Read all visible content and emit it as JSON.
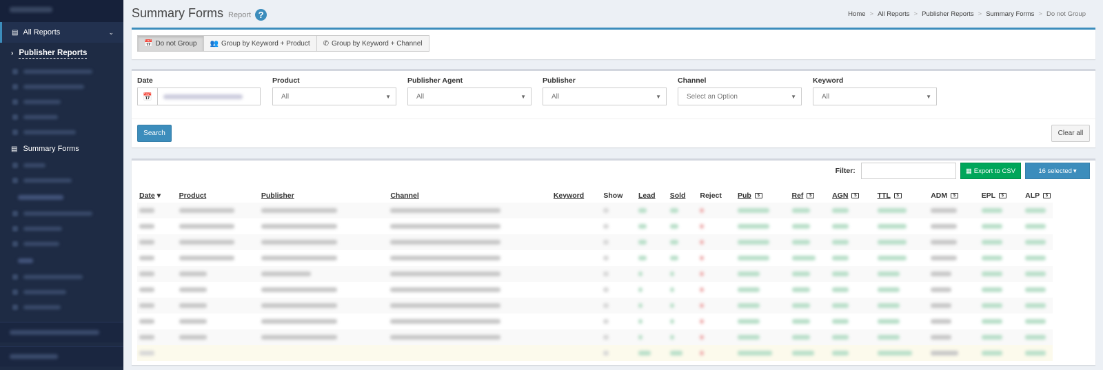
{
  "page": {
    "title": "Summary Forms",
    "subtitle": "Report",
    "help_icon": "question-circle-icon"
  },
  "breadcrumb": [
    "Home",
    "All Reports",
    "Publisher Reports",
    "Summary Forms",
    "Do not Group"
  ],
  "sidebar": {
    "all_reports_label": "All Reports",
    "publisher_reports_label": "Publisher Reports",
    "summary_forms_label": "Summary Forms",
    "accent": "#3c8dbc",
    "bg": "#1e2b44"
  },
  "group_buttons": [
    {
      "label": "Do not Group",
      "icon": "calendar-icon",
      "active": true
    },
    {
      "label": "Group by Keyword + Product",
      "icon": "users-icon",
      "active": false
    },
    {
      "label": "Group by Keyword + Channel",
      "icon": "phone-icon",
      "active": false
    }
  ],
  "filters": {
    "date": {
      "label": "Date",
      "icon": "calendar-icon"
    },
    "product": {
      "label": "Product",
      "value": "All"
    },
    "publisher_agent": {
      "label": "Publisher Agent",
      "value": "All"
    },
    "publisher": {
      "label": "Publisher",
      "value": "All"
    },
    "channel": {
      "label": "Channel",
      "value": "Select an Option"
    },
    "keyword": {
      "label": "Keyword",
      "value": "All"
    },
    "search_label": "Search",
    "clear_label": "Clear all"
  },
  "table_tools": {
    "filter_label": "Filter:",
    "export_label": "Export to CSV",
    "selected_label": "16 selected"
  },
  "table": {
    "columns": [
      "Date",
      "Product",
      "Publisher",
      "Channel",
      "Keyword",
      "Show",
      "Lead",
      "Sold",
      "Reject",
      "Pub",
      "Ref",
      "AGN",
      "TTL",
      "ADM",
      "EPL",
      "ALP"
    ],
    "row_count": 9,
    "has_total_row": true
  },
  "colors": {
    "primary": "#3c8dbc",
    "success": "#00a65a",
    "background": "#ecf0f5"
  }
}
